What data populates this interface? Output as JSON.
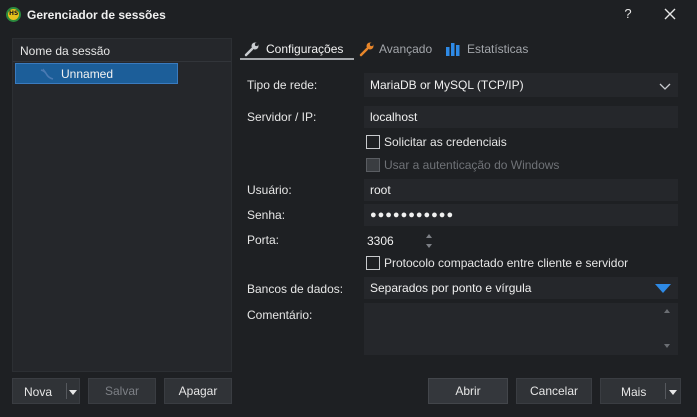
{
  "window": {
    "title": "Gerenciador de sessões",
    "icon_text": "HS",
    "help_label": "?"
  },
  "tree": {
    "header": "Nome da sessão",
    "items": [
      {
        "label": "Unnamed",
        "selected": true
      }
    ]
  },
  "left_buttons": {
    "nova": "Nova",
    "salvar": "Salvar",
    "apagar": "Apagar"
  },
  "tabs": [
    {
      "label": "Configurações",
      "icon": "wrench-icon",
      "active": true
    },
    {
      "label": "Avançado",
      "icon": "wrench-orange-icon",
      "active": false
    },
    {
      "label": "Estatísticas",
      "icon": "bar-chart-icon",
      "active": false
    }
  ],
  "form": {
    "tipo_rede": {
      "label": "Tipo de rede:",
      "value": "MariaDB or MySQL (TCP/IP)"
    },
    "servidor": {
      "label": "Servidor / IP:",
      "value": "localhost"
    },
    "solicitar_credenciais": {
      "label": "Solicitar as credenciais",
      "checked": false
    },
    "usar_auth_windows": {
      "label": "Usar a autenticação do Windows",
      "checked": false,
      "disabled": true
    },
    "usuario": {
      "label": "Usuário:",
      "value": "root"
    },
    "senha": {
      "label": "Senha:",
      "value": "●●●●●●●●●●●"
    },
    "porta": {
      "label": "Porta:",
      "value": "3306"
    },
    "protocolo_compactado": {
      "label": "Protocolo compactado entre cliente e servidor",
      "checked": false
    },
    "bancos": {
      "label": "Bancos de dados:",
      "placeholder": "Separados por ponto e vírgula"
    },
    "comentario": {
      "label": "Comentário:",
      "value": ""
    }
  },
  "right_buttons": {
    "abrir": "Abrir",
    "cancelar": "Cancelar",
    "mais": "Mais"
  },
  "colors": {
    "background": "#1e2023",
    "field": "#25272b",
    "selection": "#1c5e99",
    "accent_blue": "#2e8ae6",
    "icon_orange": "#e8862a"
  }
}
